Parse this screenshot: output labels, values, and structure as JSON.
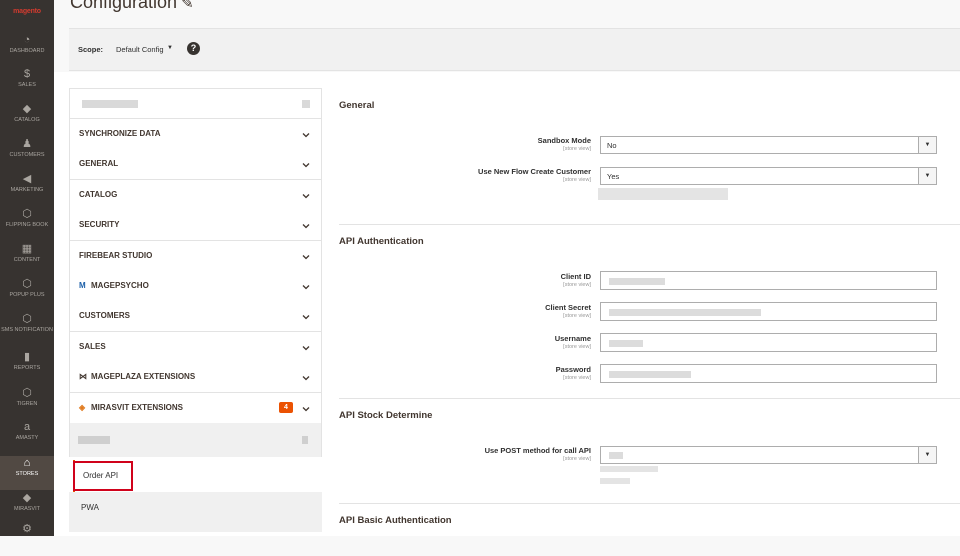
{
  "header": {
    "title": "Configuration",
    "pin_icon": "pin-icon"
  },
  "scope": {
    "label": "Scope:",
    "value": "Default Config",
    "help_icon": "question-icon"
  },
  "nav": [
    {
      "label": "DASHBOARD",
      "icon": "dashboard-icon",
      "glyph": "◔"
    },
    {
      "label": "SALES",
      "icon": "dollar-icon",
      "glyph": "$"
    },
    {
      "label": "CATALOG",
      "icon": "cube-icon",
      "glyph": "◆"
    },
    {
      "label": "CUSTOMERS",
      "icon": "person-icon",
      "glyph": "♟"
    },
    {
      "label": "MARKETING",
      "icon": "megaphone-icon",
      "glyph": "◀"
    },
    {
      "label": "FLIPPING BOOK",
      "icon": "hexagon-icon",
      "glyph": "⬡"
    },
    {
      "label": "CONTENT",
      "icon": "layout-icon",
      "glyph": "▦"
    },
    {
      "label": "POPUP PLUS",
      "icon": "hexagon-icon",
      "glyph": "⬡"
    },
    {
      "label": "SMS NOTIFICATION",
      "icon": "hexagon-icon",
      "glyph": "⬡"
    },
    {
      "label": "REPORTS",
      "icon": "bar-chart-icon",
      "glyph": "▮"
    },
    {
      "label": "TIGREN",
      "icon": "hexagon-icon",
      "glyph": "⬡"
    },
    {
      "label": "AMASTY",
      "icon": "amasty-icon",
      "glyph": "a"
    },
    {
      "label": "STORES",
      "icon": "store-icon",
      "glyph": "⌂"
    },
    {
      "label": "MIRASVIT",
      "icon": "diamond-icon",
      "glyph": "◆"
    },
    {
      "label": "",
      "icon": "gear-icon",
      "glyph": "⚙"
    }
  ],
  "tabs": [
    {
      "label": "SYNCHRONIZE DATA"
    },
    {
      "label": "GENERAL"
    },
    {
      "label": "CATALOG"
    },
    {
      "label": "SECURITY"
    },
    {
      "label": "FIREBEAR STUDIO"
    },
    {
      "label": "MAGEPSYCHO",
      "icon": "magepsycho-logo-icon"
    },
    {
      "label": "CUSTOMERS"
    },
    {
      "label": "SALES"
    },
    {
      "label": "MAGEPLAZA EXTENSIONS",
      "icon": "mageplaza-logo-icon"
    },
    {
      "label": "MIRASVIT EXTENSIONS",
      "icon": "mirasvit-logo-icon",
      "badge": "4"
    }
  ],
  "subitems": [
    {
      "label": "Order API"
    },
    {
      "label": "PWA"
    }
  ],
  "sections": {
    "general": {
      "title": "General",
      "sandbox": {
        "label": "Sandbox Mode",
        "scope": "[store view]",
        "value": "No"
      },
      "newflow": {
        "label": "Use New Flow Create Customer",
        "scope": "[store view]",
        "value": "Yes"
      }
    },
    "auth": {
      "title": "API Authentication",
      "client_id": {
        "label": "Client ID",
        "scope": "[store view]"
      },
      "client_secret": {
        "label": "Client Secret",
        "scope": "[store view]"
      },
      "username": {
        "label": "Username",
        "scope": "[store view]"
      },
      "password": {
        "label": "Password",
        "scope": "[store view]"
      }
    },
    "stock": {
      "title": "API Stock Determine",
      "post": {
        "label": "Use POST method for call API",
        "scope": "[store view]"
      }
    },
    "basic": {
      "title": "API Basic Authentication"
    }
  }
}
